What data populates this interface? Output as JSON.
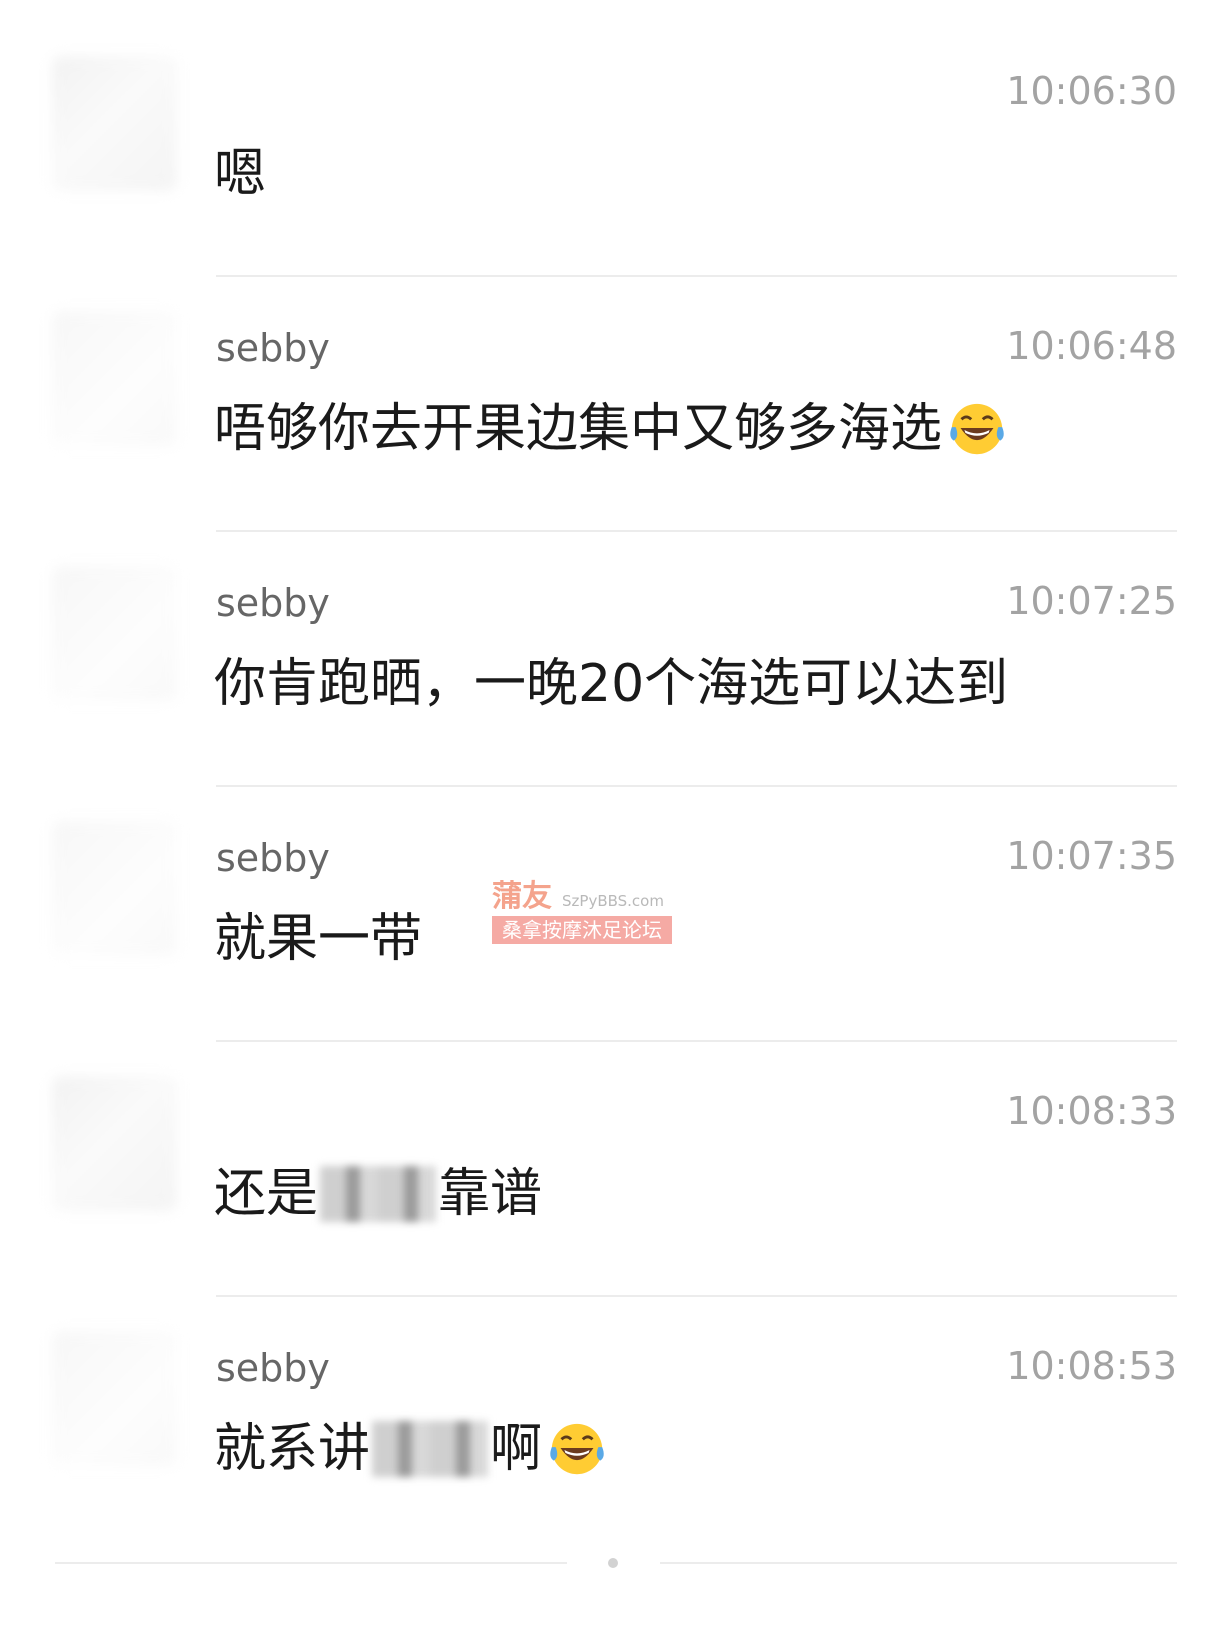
{
  "messages": [
    {
      "sender": "",
      "time": "10:06:30",
      "text": "嗯"
    },
    {
      "sender": "sebby",
      "time": "10:06:48",
      "text": "唔够你去开果边集中又够多海选",
      "emoji": "laughing-tears-emoji"
    },
    {
      "sender": "sebby",
      "time": "10:07:25",
      "text": "你肯跑晒，一晚20个海选可以达到"
    },
    {
      "sender": "sebby",
      "time": "10:07:35",
      "text": "就果一带"
    },
    {
      "sender": "",
      "time": "10:08:33",
      "text_before": "还是",
      "text_after": "靠谱"
    },
    {
      "sender": "sebby",
      "time": "10:08:53",
      "text_before": "就系讲",
      "text_after": "啊",
      "emoji": "laughing-tears-emoji"
    }
  ],
  "watermark": {
    "title": "蒲友",
    "site": "SzPyBBS.com",
    "subtitle": "桑拿按摩沐足论坛"
  },
  "colors": {
    "text": "#1a1a1a",
    "sender": "#666666",
    "timestamp": "#a3a3a3",
    "divider": "#ececec",
    "watermark_accent": "#f5aaa4"
  }
}
